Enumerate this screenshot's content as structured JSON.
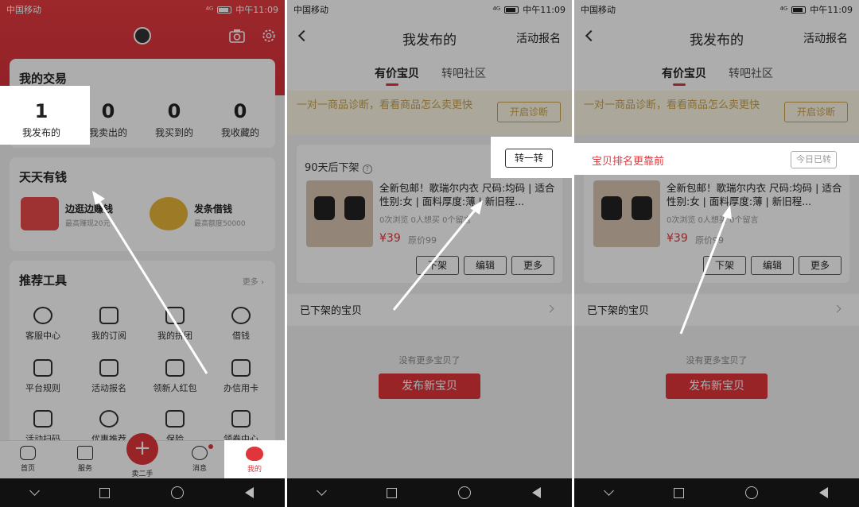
{
  "status": {
    "carrier": "中国移动",
    "time": "中午11:09",
    "signal": "⁴ᴳ"
  },
  "panel1": {
    "transactions_title": "我的交易",
    "stats": [
      {
        "num": "1",
        "label": "我发布的"
      },
      {
        "num": "0",
        "label": "我卖出的"
      },
      {
        "num": "0",
        "label": "我买到的"
      },
      {
        "num": "0",
        "label": "我收藏的"
      }
    ],
    "money_title": "天天有钱",
    "promos": [
      {
        "title": "边逛边赚钱",
        "sub": "最高赚现20元"
      },
      {
        "title": "发条借钱",
        "sub": "最高额度50000"
      }
    ],
    "tools_title": "推荐工具",
    "tools_more": "更多 ›",
    "tools": [
      {
        "label": "客服中心",
        "icon": "customer-service-icon"
      },
      {
        "label": "我的订阅",
        "icon": "subscription-icon"
      },
      {
        "label": "我的拼团",
        "icon": "group-buy-icon"
      },
      {
        "label": "借钱",
        "icon": "money-bag-icon"
      },
      {
        "label": "平台规则",
        "icon": "rules-icon"
      },
      {
        "label": "活动报名",
        "icon": "megaphone-icon"
      },
      {
        "label": "领新人红包",
        "icon": "red-packet-icon"
      },
      {
        "label": "办信用卡",
        "icon": "credit-card-icon"
      },
      {
        "label": "活动扫码",
        "icon": "scan-icon"
      },
      {
        "label": "优惠推荐",
        "icon": "coupon-icon"
      },
      {
        "label": "保险",
        "icon": "shield-icon"
      },
      {
        "label": "领券中心",
        "icon": "ticket-icon"
      }
    ],
    "tabs": [
      {
        "label": "首页",
        "icon": "home-icon"
      },
      {
        "label": "服务",
        "icon": "service-icon"
      },
      {
        "label": "卖二手",
        "icon": "plus-icon"
      },
      {
        "label": "消息",
        "icon": "message-icon"
      },
      {
        "label": "我的",
        "icon": "mine-icon"
      }
    ],
    "sell_symbol": "+"
  },
  "panel2": {
    "title": "我发布的",
    "activity": "活动报名",
    "tab_paid": "有价宝贝",
    "tab_community": "转吧社区",
    "banner_text": "一对一商品诊断，看看商品怎么卖更快",
    "banner_button": "开启诊断",
    "offline_days": "90天后下架",
    "rotate_button": "转一转",
    "product_text": "全新包邮！歌瑞尔内衣 尺码:均码 | 适合性别:女 | 面料厚度:薄 | 新旧程...",
    "product_stats": "0次浏览 0人想买 0个留言",
    "price": "¥39",
    "original_price": "原价99",
    "btn_delist": "下架",
    "btn_edit": "编辑",
    "btn_more": "更多",
    "offline_items": "已下架的宝贝",
    "no_more": "没有更多宝贝了",
    "publish": "发布新宝贝"
  },
  "panel3": {
    "rank_text": "宝贝排名更靠前",
    "today_button": "今日已转"
  },
  "colors": {
    "brand_red": "#e0363b",
    "banner_gold": "#c9a24b"
  }
}
